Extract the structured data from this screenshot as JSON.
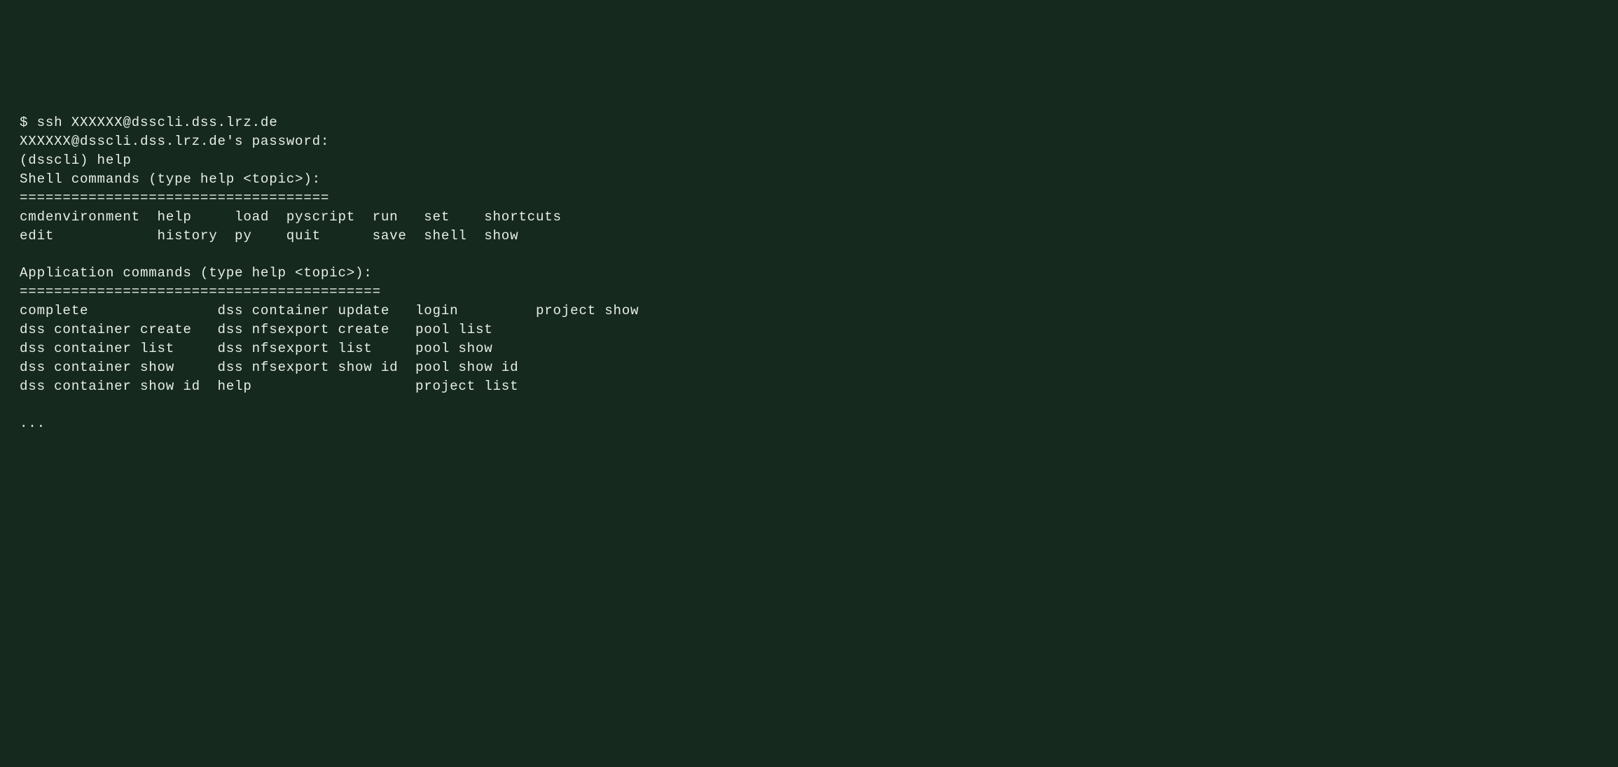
{
  "terminal": {
    "lines": [
      "$ ssh XXXXXX@dsscli.dss.lrz.de",
      "XXXXXX@dsscli.dss.lrz.de's password:",
      "(dsscli) help",
      "Shell commands (type help <topic>):",
      "====================================",
      "cmdenvironment  help     load  pyscript  run   set    shortcuts",
      "edit            history  py    quit      save  shell  show",
      "",
      "Application commands (type help <topic>):",
      "==========================================",
      "complete               dss container update   login         project show",
      "dss container create   dss nfsexport create   pool list",
      "dss container list     dss nfsexport list     pool show",
      "dss container show     dss nfsexport show id  pool show id",
      "dss container show id  help                   project list",
      "",
      "..."
    ]
  },
  "session": {
    "ssh_command": "$ ssh XXXXXX@dsscli.dss.lrz.de",
    "password_prompt": "XXXXXX@dsscli.dss.lrz.de's password:",
    "shell_prompt": "(dsscli) help",
    "shell_commands_header": "Shell commands (type help <topic>):",
    "shell_commands_separator": "====================================",
    "shell_commands": [
      "cmdenvironment",
      "help",
      "load",
      "pyscript",
      "run",
      "set",
      "shortcuts",
      "edit",
      "history",
      "py",
      "quit",
      "save",
      "shell",
      "show"
    ],
    "app_commands_header": "Application commands (type help <topic>):",
    "app_commands_separator": "==========================================",
    "app_commands": [
      "complete",
      "dss container update",
      "login",
      "project show",
      "dss container create",
      "dss nfsexport create",
      "pool list",
      "dss container list",
      "dss nfsexport list",
      "pool show",
      "dss container show",
      "dss nfsexport show id",
      "pool show id",
      "dss container show id",
      "help",
      "project list"
    ],
    "ellipsis": "..."
  }
}
